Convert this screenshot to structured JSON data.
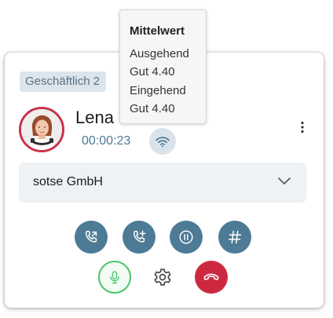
{
  "call": {
    "tag": "Geschäftlich 2",
    "caller_name": "Lena",
    "duration": "00:00:23",
    "company": "sotse GmbH"
  },
  "tooltip": {
    "title": "Mittelwert",
    "lines": [
      "Ausgehend",
      "Gut 4.40",
      "Eingehend",
      "Gut 4.40"
    ]
  },
  "icons": {
    "signal": "wifi-icon",
    "more": "more-vertical-icon",
    "dropdown": "chevron-down-icon",
    "transfer": "phone-transfer-icon",
    "add_call": "phone-add-icon",
    "hold": "pause-icon",
    "keypad": "hash-icon",
    "mic": "microphone-icon",
    "settings": "gear-icon",
    "hangup": "phone-hangup-icon"
  },
  "colors": {
    "accent": "#4d7b96",
    "hangup": "#cc2940",
    "mic_active": "#4cc46a",
    "avatar_ring": "#c8334a",
    "tag_bg": "#dde5ec"
  }
}
